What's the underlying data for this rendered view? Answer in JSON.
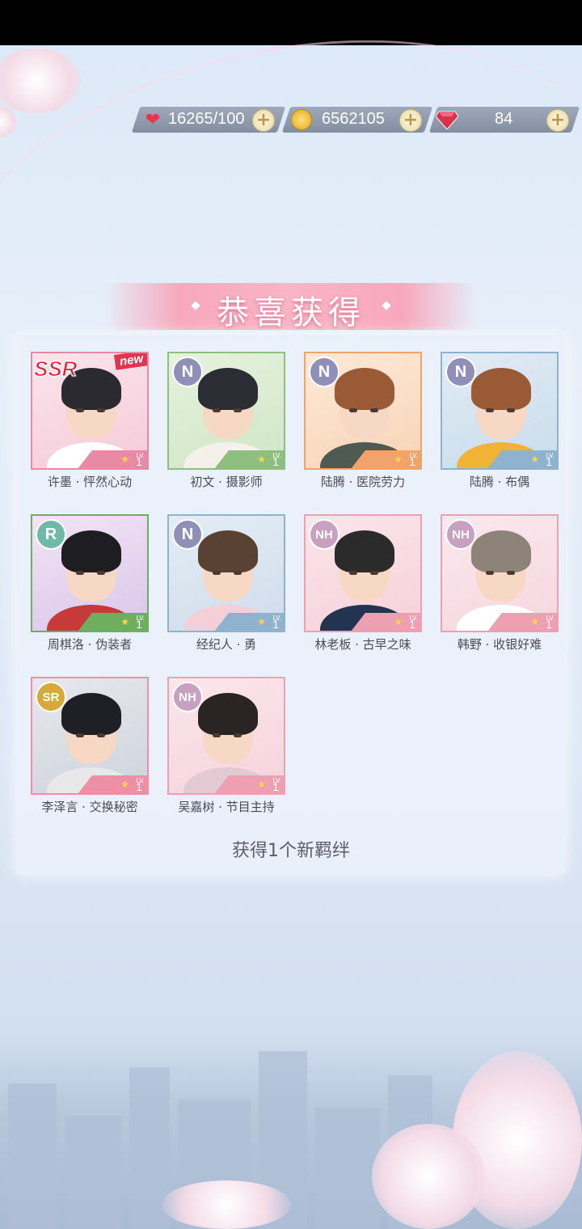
{
  "resources": {
    "stamina": {
      "value": "16265/100",
      "icon": "heart-icon"
    },
    "gold": {
      "value": "6562105",
      "icon": "coin-icon"
    },
    "diamond": {
      "value": "84",
      "icon": "gem-icon"
    }
  },
  "banner": {
    "title": "恭喜获得"
  },
  "cards": [
    {
      "rarity": "SSR",
      "is_new": true,
      "new_label": "new",
      "name": "许墨 · 怦然心动",
      "level": "1",
      "lv_label": "LV."
    },
    {
      "rarity": "N",
      "is_new": false,
      "name": "初文 · 摄影师",
      "level": "1",
      "lv_label": "LV."
    },
    {
      "rarity": "N",
      "is_new": false,
      "name": "陆腾 · 医院劳力",
      "level": "1",
      "lv_label": "LV."
    },
    {
      "rarity": "N",
      "is_new": false,
      "name": "陆腾 · 布偶",
      "level": "1",
      "lv_label": "LV."
    },
    {
      "rarity": "R",
      "is_new": false,
      "name": "周棋洛 · 伪装者",
      "level": "1",
      "lv_label": "LV."
    },
    {
      "rarity": "N",
      "is_new": false,
      "name": "经纪人 · 勇",
      "level": "1",
      "lv_label": "LV."
    },
    {
      "rarity": "NH",
      "is_new": false,
      "name": "林老板 · 古早之味",
      "level": "1",
      "lv_label": "LV."
    },
    {
      "rarity": "NH",
      "is_new": false,
      "name": "韩野 · 收银好难",
      "level": "1",
      "lv_label": "LV."
    },
    {
      "rarity": "SR",
      "is_new": false,
      "name": "李泽言 · 交换秘密",
      "level": "1",
      "lv_label": "LV."
    },
    {
      "rarity": "NH",
      "is_new": false,
      "name": "吴嘉树 · 节目主持",
      "level": "1",
      "lv_label": "LV."
    }
  ],
  "summary": "获得1个新羁绊",
  "colors": {
    "ssr": "#e88aa6",
    "n_green": "#8fbf7f",
    "n_orange": "#f0a36b",
    "n_blue": "#8fb3cf",
    "r": "#6fae5f",
    "nh": "#ef9fb2",
    "sr": "#ef8fa6"
  }
}
